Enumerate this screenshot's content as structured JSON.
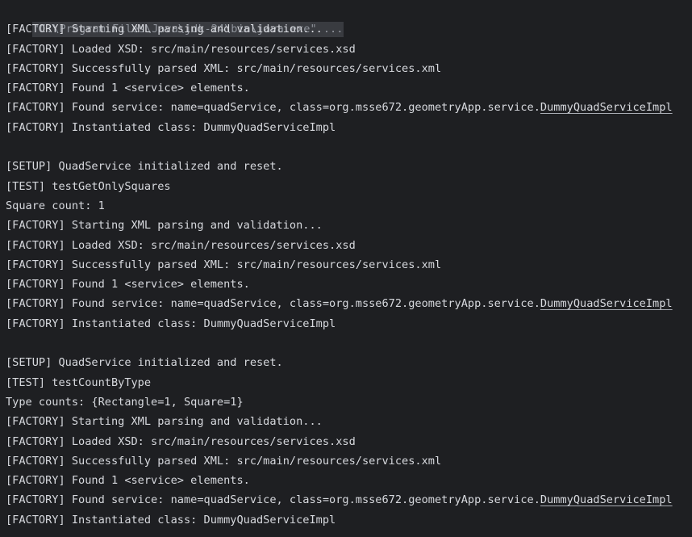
{
  "command_line": "\"C:\\Program Files\\Java\\jdk-24\\bin\\java.exe\" ...",
  "blocks": [
    {
      "factory_start": "[FACTORY] Starting XML parsing and validation...",
      "factory_xsd": "[FACTORY] Loaded XSD: src/main/resources/services.xsd",
      "factory_parsed": "[FACTORY] Successfully parsed XML: src/main/resources/services.xml",
      "factory_found_count": "[FACTORY] Found 1 <service> elements.",
      "factory_found_prefix": "[FACTORY] Found service: name=quadService, class=org.msse672.geometryApp.service.",
      "factory_found_link": "DummyQuadServiceImpl",
      "factory_instantiated": "[FACTORY] Instantiated class: DummyQuadServiceImpl"
    },
    {
      "setup": "[SETUP] QuadService initialized and reset.",
      "test": "[TEST] testGetOnlySquares",
      "result": "Square count: 1",
      "factory_start": "[FACTORY] Starting XML parsing and validation...",
      "factory_xsd": "[FACTORY] Loaded XSD: src/main/resources/services.xsd",
      "factory_parsed": "[FACTORY] Successfully parsed XML: src/main/resources/services.xml",
      "factory_found_count": "[FACTORY] Found 1 <service> elements.",
      "factory_found_prefix": "[FACTORY] Found service: name=quadService, class=org.msse672.geometryApp.service.",
      "factory_found_link": "DummyQuadServiceImpl",
      "factory_instantiated": "[FACTORY] Instantiated class: DummyQuadServiceImpl"
    },
    {
      "setup": "[SETUP] QuadService initialized and reset.",
      "test": "[TEST] testCountByType",
      "result": "Type counts: {Rectangle=1, Square=1}",
      "factory_start": "[FACTORY] Starting XML parsing and validation...",
      "factory_xsd": "[FACTORY] Loaded XSD: src/main/resources/services.xsd",
      "factory_parsed": "[FACTORY] Successfully parsed XML: src/main/resources/services.xml",
      "factory_found_count": "[FACTORY] Found 1 <service> elements.",
      "factory_found_prefix": "[FACTORY] Found service: name=quadService, class=org.msse672.geometryApp.service.",
      "factory_found_link": "DummyQuadServiceImpl",
      "factory_instantiated": "[FACTORY] Instantiated class: DummyQuadServiceImpl"
    }
  ],
  "colors": {
    "background": "#1e1f22",
    "text": "#d7d9de",
    "command_bg": "#393b40",
    "command_text": "#8f939b"
  }
}
